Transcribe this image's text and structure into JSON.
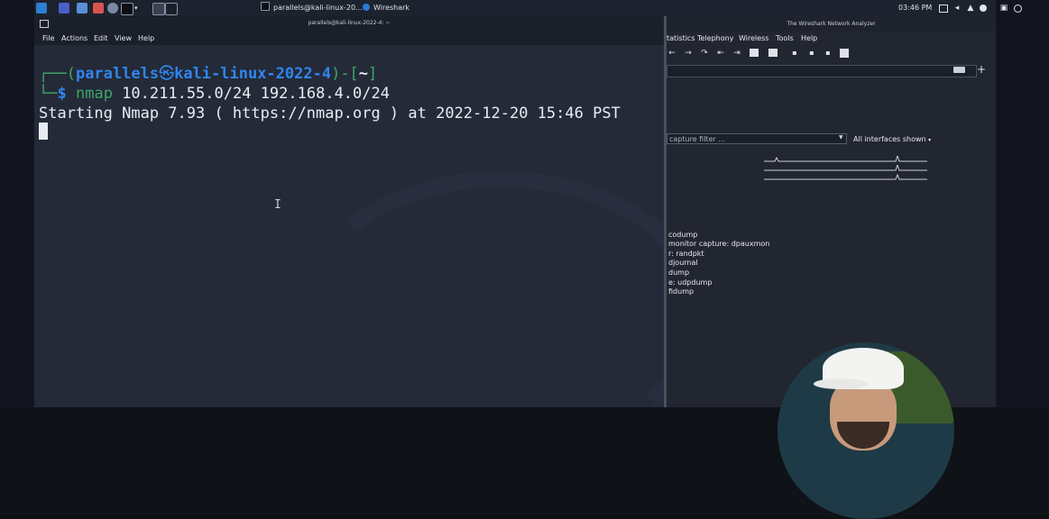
{
  "taskbar": {
    "tasks": [
      {
        "label": "parallels@kali-linux-20..."
      },
      {
        "label": "Wireshark"
      }
    ],
    "clock": "03:46 PM"
  },
  "terminal": {
    "title": "parallels@kali-linux-2022-4: ~",
    "menu": [
      "File",
      "Actions",
      "Edit",
      "View",
      "Help"
    ],
    "prompt": {
      "open": "┌──(",
      "user": "parallels",
      "at": "㉿",
      "host": "kali-linux-2022-4",
      "mid": ")-[",
      "dir": "~",
      "close": "]",
      "line2_prefix": "└─",
      "dollar": "$",
      "command": "nmap",
      "args": " 10.211.55.0/24 192.168.4.0/24"
    },
    "output": "Starting Nmap 7.93 ( https://nmap.org ) at 2022-12-20 15:46 PST"
  },
  "wireshark": {
    "title": "The Wireshark Network Analyzer",
    "menu": [
      "Statistics",
      "Telephony",
      "Wireless",
      "Tools",
      "Help"
    ],
    "menu_partial": "tatistics",
    "capture_filter_placeholder": "capture filter ...",
    "interfaces_dropdown": "All interfaces shown",
    "interfaces": [
      "codump",
      "monitor capture: dpauxmon",
      "r: randpkt",
      "djournal",
      "dump",
      "e: udpdump",
      "fidump"
    ]
  },
  "colors": {
    "accent": "#2a7bd4",
    "prompt_blue": "#2f86ef",
    "prompt_green": "#3fa66a",
    "terminal_bg": "#242a38"
  }
}
